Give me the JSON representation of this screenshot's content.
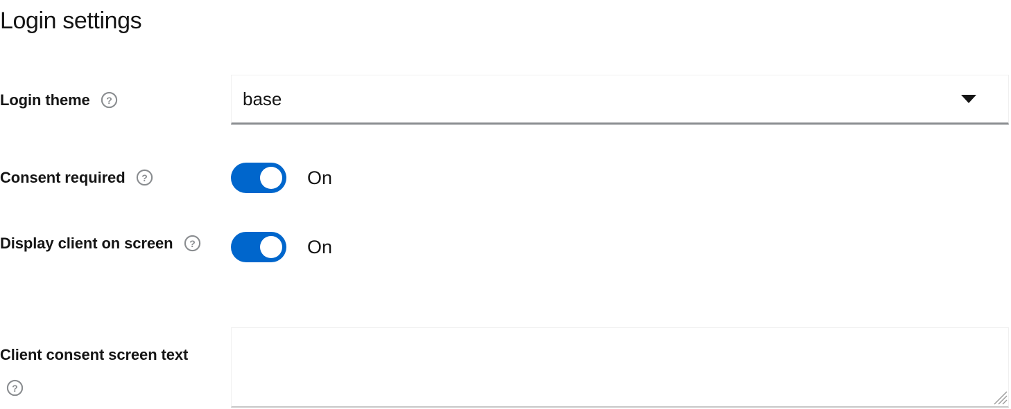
{
  "page": {
    "title": "Login settings"
  },
  "icons": {
    "help": "help-circle-question-icon",
    "caret": "chevron-down-icon",
    "resize": "resize-grip-icon"
  },
  "colors": {
    "accent_blue": "#0066CC",
    "text": "#151515",
    "help_icon_gray": "#8A8D90",
    "select_underline": "#8A8D90",
    "field_border": "#F0F0F0"
  },
  "fields": {
    "login_theme": {
      "label": "Login theme",
      "help": "?",
      "control": "select",
      "value": "base",
      "options": [
        "base"
      ]
    },
    "consent_required": {
      "label": "Consent required",
      "help": "?",
      "control": "switch",
      "checked": true,
      "state_label": "On"
    },
    "display_client_on_screen": {
      "label": "Display client on screen",
      "help": "?",
      "control": "switch",
      "checked": true,
      "state_label": "On"
    },
    "client_consent_screen_text": {
      "label": "Client consent screen text",
      "help": "?",
      "control": "textarea",
      "value": "",
      "placeholder": ""
    }
  }
}
